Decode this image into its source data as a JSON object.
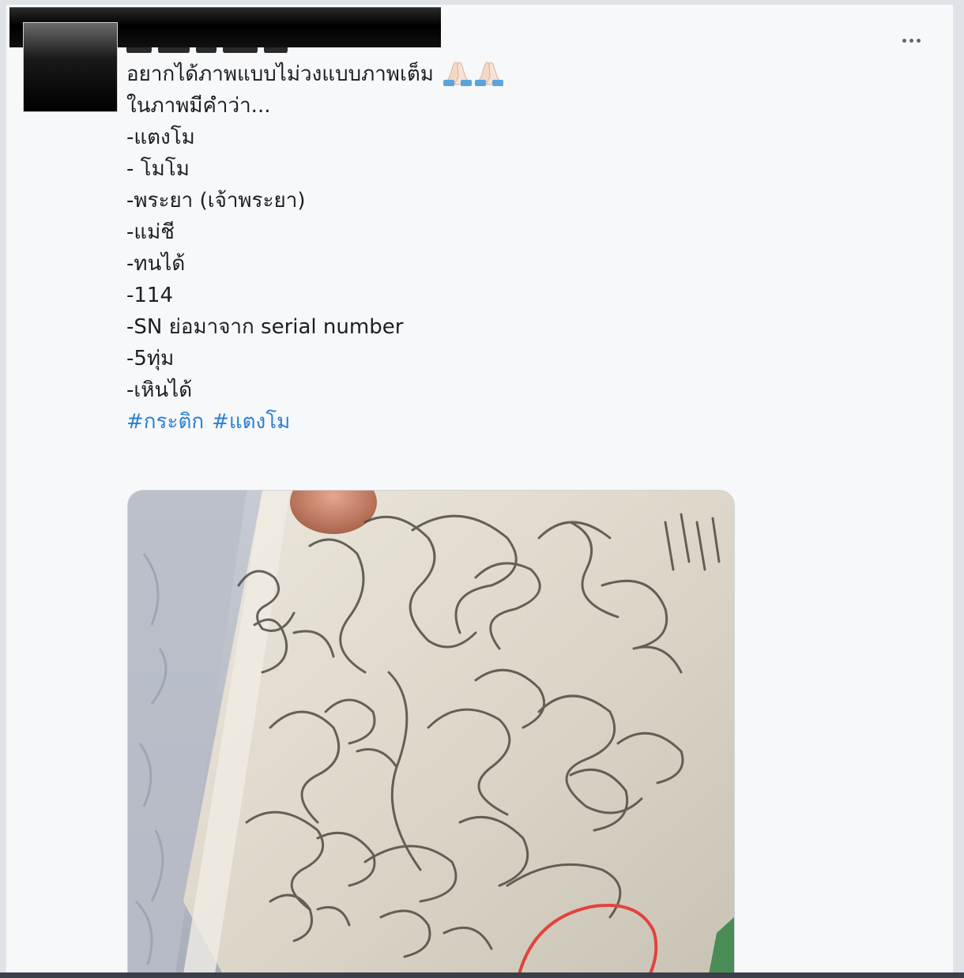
{
  "post": {
    "menu_icon": "more-horizontal-icon",
    "lines": [
      "อยากได้ภาพแบบไม่วงแบบภาพเต็ม",
      "ในภาพมีคำว่า...",
      "-แตงโม",
      "- โมโม",
      "-พระยา (เจ้าพระยา)",
      "-แม่ชี",
      "-ทนได้",
      "-114",
      "-SN ย่อมาจาก serial number",
      "-5ทุ่ม",
      "-เหินได้"
    ],
    "emoji": "🙏🏻🙏🏻",
    "hashtags": [
      "#กระติก",
      "#แตงโม"
    ],
    "accent_color": "#2b7fd4"
  }
}
